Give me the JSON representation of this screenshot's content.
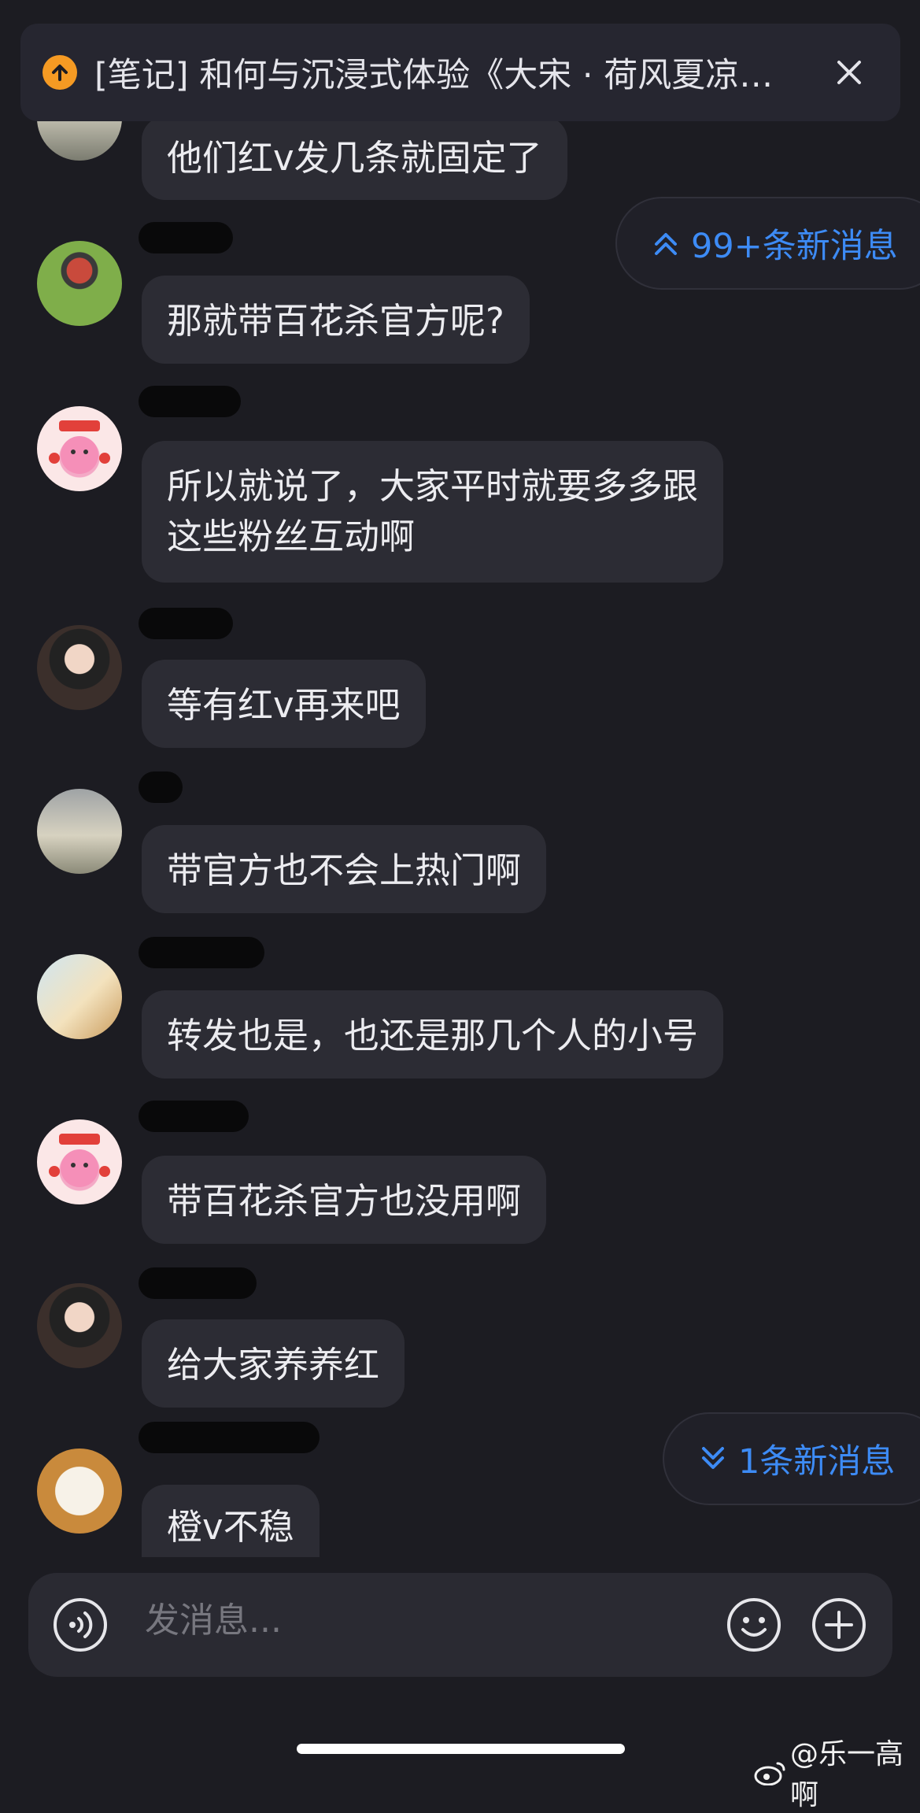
{
  "banner": {
    "text": "[笔记] 和何与沉浸式体验《大宋 · 荷风夏凉…",
    "icon": "upload-arrow-icon",
    "close_icon": "close-icon",
    "accent": "#f59a23"
  },
  "new_messages_top": {
    "label": "99+条新消息",
    "icon": "double-chevron-up-icon"
  },
  "new_messages_bottom": {
    "label": "1条新消息",
    "icon": "double-chevron-down-icon"
  },
  "messages": [
    {
      "text": "他们红ⅴ发几条就固定了"
    },
    {
      "text": "那就带百花杀官方呢?"
    },
    {
      "line1": "所以就说了，大家平时就要多多跟",
      "line2": "这些粉丝互动啊"
    },
    {
      "text": "等有红ⅴ再来吧"
    },
    {
      "text": "带官方也不会上热门啊"
    },
    {
      "text": "转发也是，也还是那几个人的小号"
    },
    {
      "text": "带百花杀官方也没用啊"
    },
    {
      "text": "给大家养养红"
    },
    {
      "text": "橙ⅴ不稳"
    }
  ],
  "composer": {
    "placeholder": "发消息...",
    "voice_icon": "voice-icon",
    "emoji_icon": "emoji-icon",
    "add_icon": "add-icon"
  },
  "watermark": {
    "text": "@乐一高啊",
    "icon": "weibo-icon"
  },
  "colors": {
    "background": "#1c1c22",
    "bubble": "#2c2c34",
    "link_blue": "#3d8bf5"
  }
}
